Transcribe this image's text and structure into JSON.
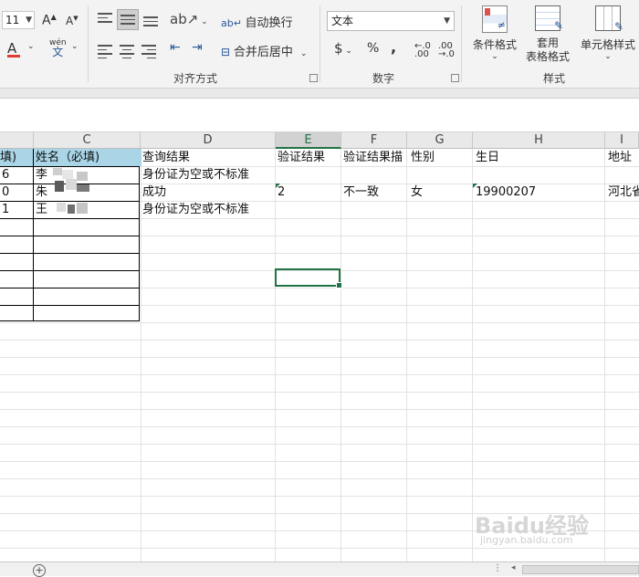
{
  "ribbon": {
    "font_size": "11",
    "grow_font": "A",
    "shrink_font": "A",
    "font_color_glyph": "A",
    "phonetic_top": "wén",
    "phonetic_bottom": "文",
    "wrap_text": "自动换行",
    "merge_center": "合并后居中",
    "number_format": "文本",
    "currency": "$",
    "percent": "%",
    "comma": ",",
    "groups": {
      "alignment": "对齐方式",
      "number": "数字",
      "styles": "样式"
    },
    "styles": {
      "conditional": "条件格式",
      "table_top": "套用",
      "table_bottom": "表格格式",
      "cell_styles": "单元格样式"
    }
  },
  "grid": {
    "columns": [
      "C",
      "D",
      "E",
      "F",
      "G",
      "H",
      "I"
    ],
    "header_row": {
      "b": "填)",
      "c": "姓名（必填)",
      "d": "查询结果",
      "e": "验证结果",
      "f": "验证结果描",
      "g": "性别",
      "h": "生日",
      "i": "地址"
    },
    "rows": [
      {
        "b": "6",
        "c": "李",
        "d": "身份证为空或不标准",
        "e": "",
        "f": "",
        "g": "",
        "h": "",
        "i": ""
      },
      {
        "b": "0",
        "c": "朱",
        "d": "成功",
        "e": "2",
        "f": "不一致",
        "g": "女",
        "h": "19900207",
        "i": "河北省"
      },
      {
        "b": "1",
        "c": "王",
        "d": "身份证为空或不标准",
        "e": "",
        "f": "",
        "g": "",
        "h": "",
        "i": ""
      }
    ]
  },
  "watermark": {
    "brand": "Baidu经验",
    "url": "jingyan.baidu.com"
  }
}
